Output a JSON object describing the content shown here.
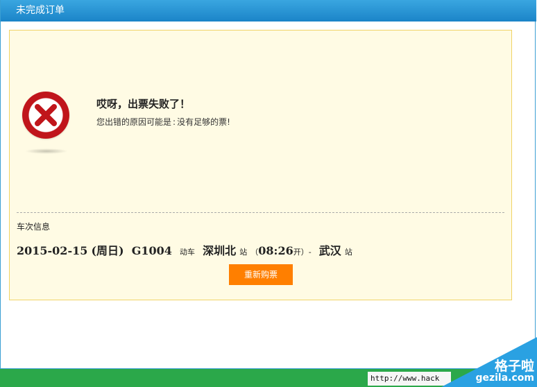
{
  "window": {
    "title": "未完成订单"
  },
  "error": {
    "title": "哎呀，出票失败了！",
    "reason_label": "您出错的原因可能是",
    "reason_text": "没有足够的票!",
    "icon": "error-x-icon"
  },
  "train": {
    "heading": "车次信息",
    "date": "2015-02-15",
    "weekday": "(周日)",
    "number": "G1004",
    "type": "动车",
    "from_station": "深圳北",
    "station_suffix": "站",
    "depart_open": "（",
    "depart_time": "08:26",
    "depart_suffix": "开）-",
    "to_station": "武汉"
  },
  "actions": {
    "rebuy_label": "重新购票"
  },
  "footer": {
    "url_text": "http://www.hack"
  },
  "watermark": {
    "cn": "格子啦",
    "en": "gezila.com"
  },
  "colors": {
    "titlebar": "#1b84c8",
    "button": "#ff7f00",
    "card_bg": "#fffbe4",
    "error_red": "#c0151b",
    "footer": "#2ba84a"
  }
}
